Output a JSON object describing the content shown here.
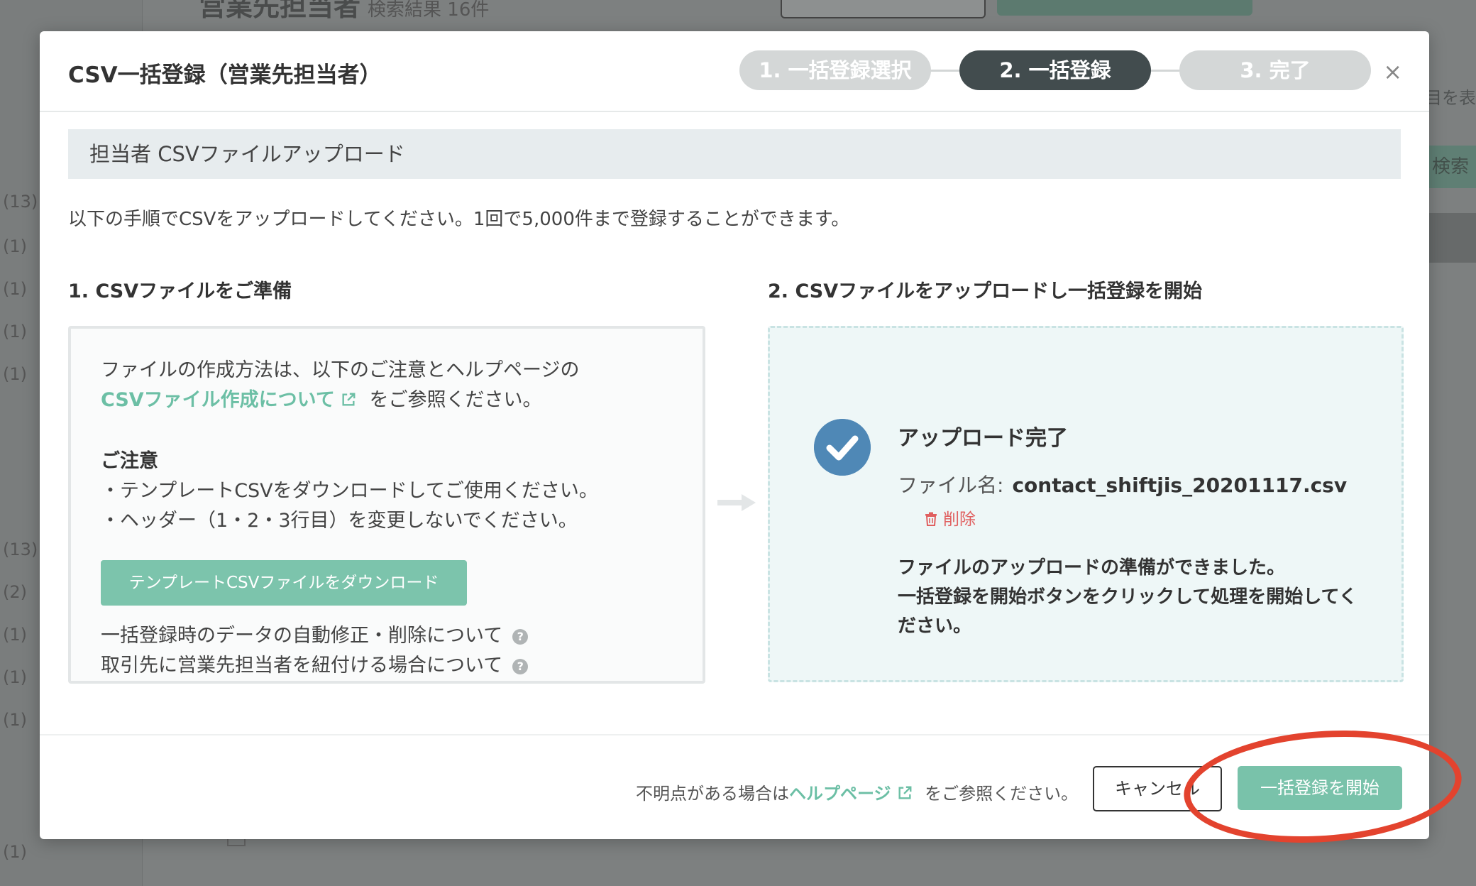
{
  "background": {
    "counts": [
      "(13)",
      "(1)",
      "(1)",
      "(1)",
      "(1)",
      "(13)",
      "(2)",
      "(1)",
      "(1)",
      "(1)",
      "(1)"
    ],
    "right_text_1": "目を表",
    "right_text_2": "検索"
  },
  "modal": {
    "title": "CSV一括登録（営業先担当者）",
    "steps": [
      {
        "label": "1. 一括登録選択",
        "state": "inactive"
      },
      {
        "label": "2. 一括登録",
        "state": "active"
      },
      {
        "label": "3. 完了",
        "state": "inactive"
      }
    ],
    "close_label": "×",
    "section_title": "担当者 CSVファイルアップロード",
    "intro": "以下の手順でCSVをアップロードしてください。1回で5,000件まで登録することができます。",
    "col1_title": "1. CSVファイルをご準備",
    "col2_title": "2. CSVファイルをアップロードし一括登録を開始",
    "prep": {
      "line1": "ファイルの作成方法は、以下のご注意とヘルプページの",
      "link": "CSVファイル作成について",
      "line2_suffix": "をご参照ください。",
      "caution_title": "ご注意",
      "caution_1": "・テンプレートCSVをダウンロードしてご使用ください。",
      "caution_2": "・ヘッダー（1・2・3行目）を変更しないでください。",
      "download_button": "テンプレートCSVファイルをダウンロード",
      "help_1": "一括登録時のデータの自動修正・削除について",
      "help_2": "取引先に営業先担当者を紐付ける場合について"
    },
    "upload": {
      "title": "アップロード完了",
      "file_label": "ファイル名:",
      "file_name": "contact_shiftjis_20201117.csv",
      "delete_label": "削除",
      "ready_line1": "ファイルのアップロードの準備ができました。",
      "ready_line2": "一括登録を開始ボタンをクリックして処理を開始してください。"
    },
    "footer": {
      "note_prefix": "不明点がある場合は",
      "help_link": "ヘルプページ",
      "note_suffix": "をご参照ください。",
      "cancel_button": "キャンセル",
      "start_button": "一括登録を開始"
    }
  },
  "colors": {
    "accent_green": "#79c2aa",
    "step_active": "#424c4e",
    "check_blue": "#4f88b6",
    "delete_red": "#e06060",
    "annotation_red": "#e3432e"
  }
}
